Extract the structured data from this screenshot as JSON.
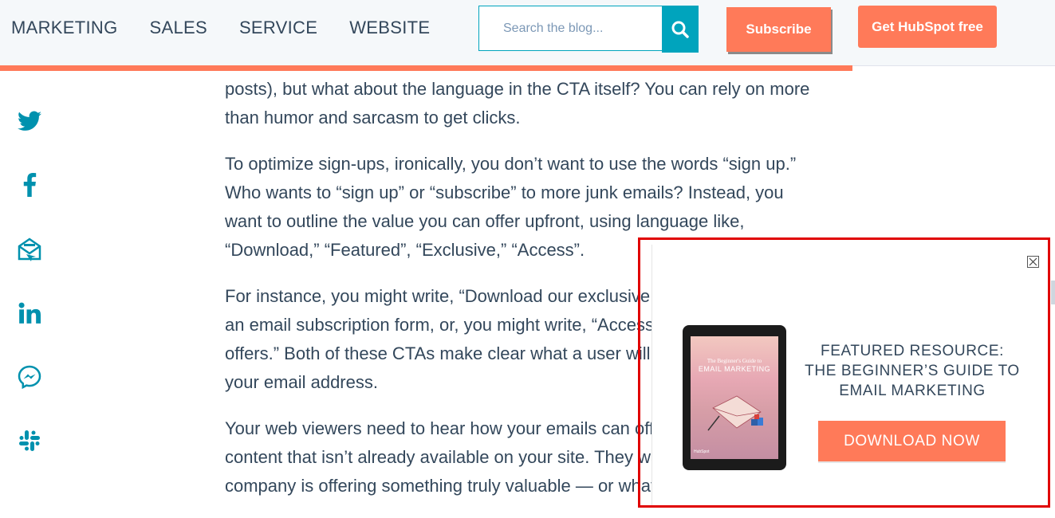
{
  "nav": {
    "items": [
      "MARKETING",
      "SALES",
      "SERVICE",
      "WEBSITE"
    ]
  },
  "search": {
    "placeholder": "Search the blog...",
    "icon": "search-icon"
  },
  "header_buttons": {
    "subscribe": "Subscribe",
    "get_hubspot": "Get HubSpot free"
  },
  "colors": {
    "accent": "#ff7a59",
    "teal": "#00a4bd",
    "text": "#33475b",
    "highlight_border": "#e00000"
  },
  "social": {
    "icons": [
      "twitter-icon",
      "facebook-icon",
      "email-icon",
      "linkedin-icon",
      "messenger-icon",
      "slack-icon"
    ]
  },
  "article": {
    "paragraphs": [
      "posts), but what about the language in the CTA itself? You can rely on more than humor and sarcasm to get clicks.",
      "To optimize sign-ups, ironically, you don’t want to use the words “sign up.” Who wants to “sign up” or “subscribe” to more junk emails? Instead, you want to outline the value you can offer upfront, using language like, “Download,” “Featured”, “Exclusive,” “Access”.",
      "For instance, you might write, “Download our exclusive guide” and include an email subscription form, or, you might write, “Access our exclusive offers.” Both of these CTAs make clear what a user will gain from providing your email address.",
      "Your web viewers need to hear how your emails can offer them exclusive content that isn’t already available on your site. They want to believe your company is offering something truly valuable — or what’s the point?"
    ]
  },
  "popup": {
    "tablet_title_small": "The Beginner's Guide to",
    "tablet_title_large": "EMAIL MARKETING",
    "tablet_brand": "HubSpot",
    "heading_line1": "FEATURED RESOURCE:",
    "heading_line2": "THE BEGINNER’S GUIDE TO",
    "heading_line3": "EMAIL MARKETING",
    "cta": "DOWNLOAD NOW",
    "close_icon": "close-icon"
  }
}
